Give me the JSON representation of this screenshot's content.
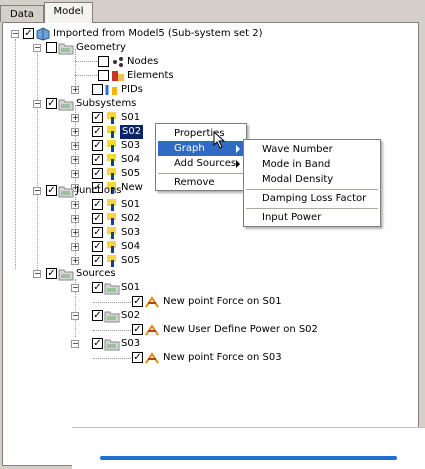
{
  "tabs": [
    {
      "label": "Data",
      "active": false
    },
    {
      "label": "Model",
      "active": true
    }
  ],
  "tree": {
    "root": "Imported from Model5 (Sub-system set 2)",
    "geometry": {
      "label": "Geometry",
      "children": [
        "Nodes",
        "Elements",
        "PIDs"
      ]
    },
    "subsystems": {
      "label": "Subsystems",
      "children": [
        "S01",
        "S02",
        "S03",
        "S04",
        "S05",
        "New"
      ]
    },
    "junctions": {
      "label": "Junctions",
      "children": [
        "S01",
        "S02",
        "S03",
        "S04",
        "S05"
      ]
    },
    "sources": {
      "label": "Sources",
      "groups": [
        {
          "label": "S01",
          "item": "New point Force on S01"
        },
        {
          "label": "S02",
          "item": "New User Define Power on S02"
        },
        {
          "label": "S03",
          "item": "New point Force on S03"
        }
      ]
    }
  },
  "context_menu": {
    "items": [
      "Properties",
      "Graph",
      "Add Sources",
      "Remove"
    ],
    "highlighted": "Graph"
  },
  "graph_submenu": {
    "items": [
      "Wave Number",
      "Mode in Band",
      "Modal Density",
      "Damping Loss Factor",
      "Input Power"
    ]
  },
  "colors": {
    "selection": "#0a246a",
    "menu_highlight": "#316ac5",
    "preview_bar": "#1f6fd1"
  },
  "icons": {
    "root": "model-icon",
    "folder": "folder-icon",
    "node": "node-icon",
    "element": "element-icon",
    "pid": "pid-icon",
    "subsystem": "subsystem-icon",
    "source": "source-icon"
  }
}
